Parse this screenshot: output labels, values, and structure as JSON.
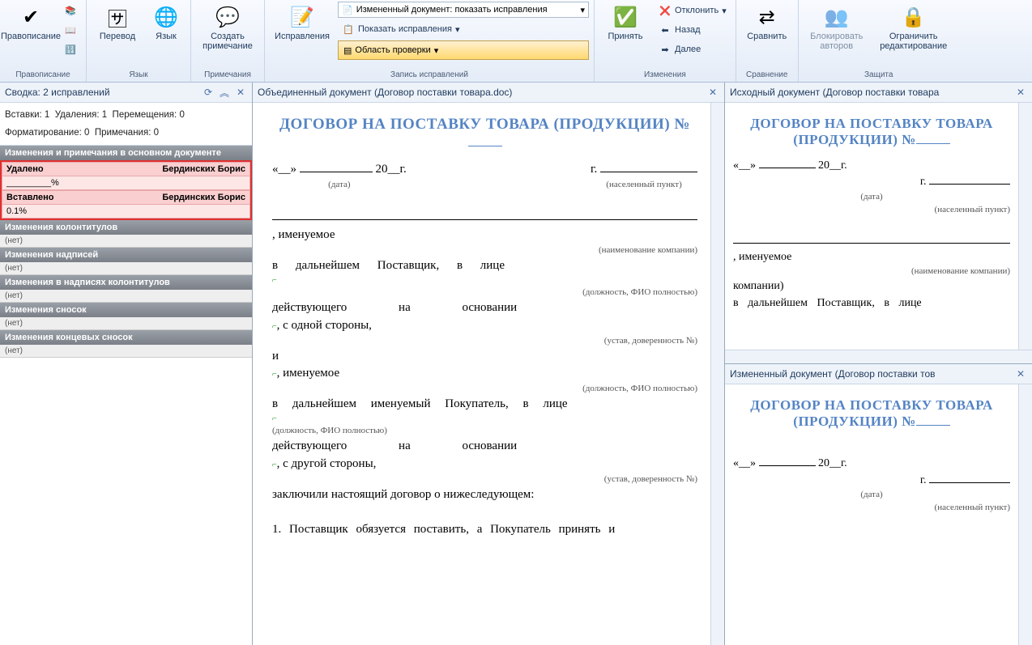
{
  "ribbon": {
    "proofing": {
      "spell": "Правописание",
      "group": "Правописание"
    },
    "language": {
      "translate": "Перевод",
      "lang": "Язык",
      "group": "Язык"
    },
    "comments": {
      "new": "Создать\nпримечание",
      "group": "Примечания"
    },
    "tracking": {
      "track": "Исправления",
      "dd1": "Измененный документ: показать исправления",
      "dd2": "Показать исправления",
      "reviewpane": "Область проверки",
      "group": "Запись исправлений"
    },
    "changes": {
      "accept": "Принять",
      "reject": "Отклонить",
      "prev": "Назад",
      "next": "Далее",
      "group": "Изменения"
    },
    "compare": {
      "compare": "Сравнить",
      "group": "Сравнение"
    },
    "protect": {
      "block": "Блокировать\nавторов",
      "restrict": "Ограничить\nредактирование",
      "group": "Защита"
    }
  },
  "summary": {
    "title": "Сводка: 2 исправлений",
    "ins_lbl": "Вставки:",
    "ins": "1",
    "del_lbl": "Удаления:",
    "del": "1",
    "mov_lbl": "Перемещения:",
    "mov": "0",
    "fmt_lbl": "Форматирование:",
    "fmt": "0",
    "com_lbl": "Примечания:",
    "com": "0",
    "sec_main": "Изменения и примечания в основном документе",
    "deleted_lbl": "Удалено",
    "author": "Бердинских Борис",
    "deleted_val": "_________%",
    "inserted_lbl": "Вставлено",
    "inserted_val": "0.1%",
    "sec_hf": "Изменения колонтитулов",
    "sec_tb": "Изменения надписей",
    "sec_tbhf": "Изменения в надписях колонтитулов",
    "sec_fn": "Изменения сносок",
    "sec_en": "Изменения концевых сносок",
    "none": "(нет)"
  },
  "panes": {
    "combined": "Объединенный документ (Договор поставки товара.doc)",
    "source": "Исходный документ (Договор поставки товара",
    "revised": "Измененный документ (Договор поставки тов"
  },
  "doc": {
    "title": "ДОГОВОР НА ПОСТАВКУ ТОВАРА (ПРОДУКЦИИ) №",
    "date_open": "«__» ",
    "date_mid": " 20__г.",
    "city_g": "г.",
    "date_lbl": "(дата)",
    "city_lbl": "(населенный пункт)",
    "named": ", именуемое",
    "company_lbl": "(наименование компании)",
    "line_supplier": "в дальнейшем Поставщик, в лице",
    "pos_fio": "(должность, ФИО полностью)",
    "acting_on": "действующего на основании",
    "side1": ", с одной стороны,",
    "charter": "(устав, доверенность №)",
    "and": "и",
    "line_buyer": "в дальнейшем именуемый Покупатель, в лице",
    "side2": ", с другой стороны,",
    "concluded": "заключили настоящий договор о нижеследующем:",
    "p1": "1. Поставщик обязуется поставить, а Покупатель принять и"
  }
}
